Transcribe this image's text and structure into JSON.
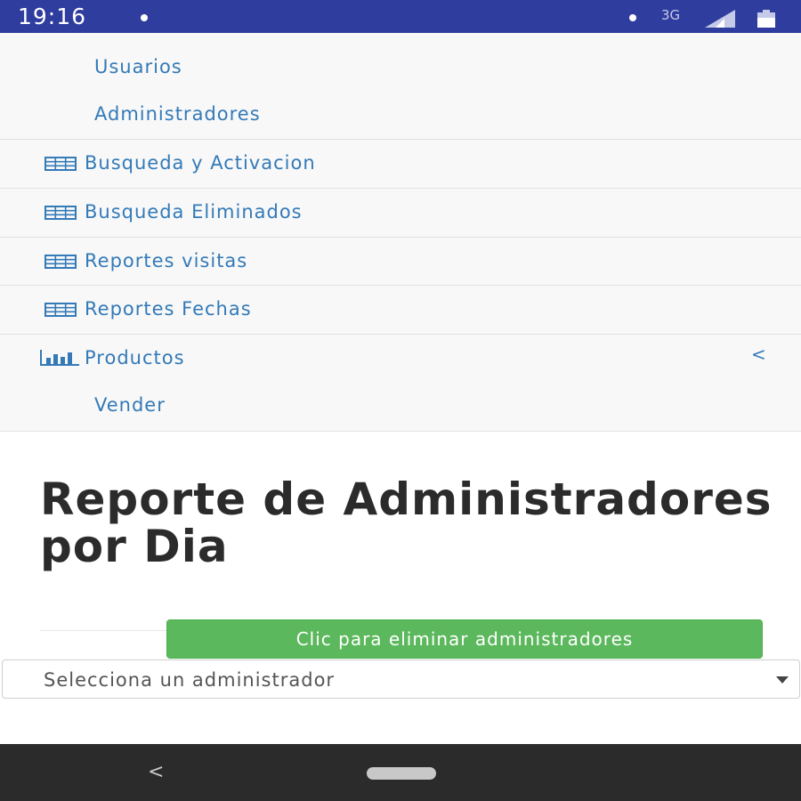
{
  "status_bar": {
    "time": "19:16",
    "network": "3G",
    "icons": [
      "notification-dot-icon",
      "signal-icon",
      "battery-icon"
    ]
  },
  "menu": {
    "sub_items_top": [
      {
        "label": "Usuarios"
      },
      {
        "label": "Administradores"
      }
    ],
    "items": [
      {
        "label": "Busqueda y Activacion",
        "icon": "table-icon"
      },
      {
        "label": "Busqueda Eliminados",
        "icon": "table-icon"
      },
      {
        "label": "Reportes visitas",
        "icon": "table-icon"
      },
      {
        "label": "Reportes Fechas",
        "icon": "table-icon"
      },
      {
        "label": "Productos",
        "icon": "bar-chart-icon",
        "expand_indicator": "<"
      }
    ],
    "sub_items_bottom": [
      {
        "label": "Vender"
      }
    ]
  },
  "main": {
    "title": "Reporte de Administradores por Dia",
    "delete_button_label": "Clic para eliminar administradores",
    "admin_select": {
      "selected": "Selecciona un administrador"
    }
  },
  "nav_bar": {
    "back_glyph": "<"
  },
  "colors": {
    "status_bar": "#2f3e9e",
    "menu_link": "#337ab7",
    "menu_background": "#f8f8f8",
    "success_button": "#5cb85c",
    "nav_bar": "#2b2b2b"
  }
}
